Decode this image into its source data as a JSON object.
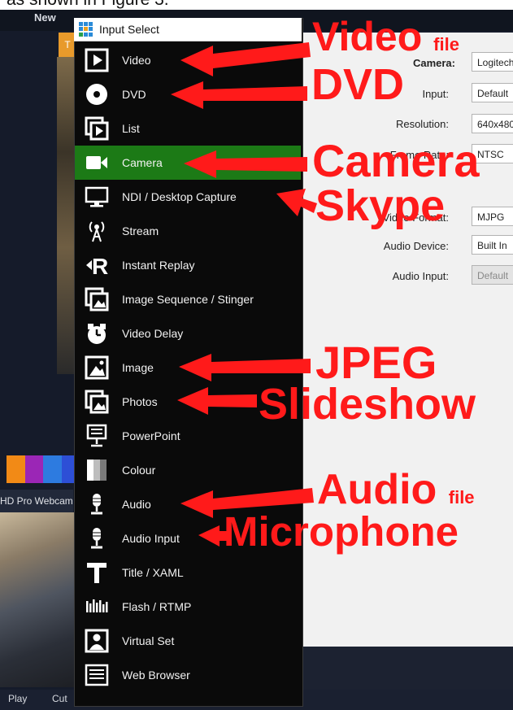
{
  "document": {
    "caption_fragment": "as shown in Figure 3."
  },
  "app": {
    "new_label": "New",
    "orange_tab_label": "T",
    "webcam_label": "HD Pro Webcam",
    "bottom_buttons": [
      "Play",
      "Cut"
    ],
    "swatch_colors": [
      "#f28a16",
      "#9b26b6",
      "#2d7be0",
      "#2d4fd6"
    ]
  },
  "dialog": {
    "title": "Input Select",
    "items": [
      {
        "label": "Video",
        "icon": "video-file-icon"
      },
      {
        "label": "DVD",
        "icon": "disc-icon"
      },
      {
        "label": "List",
        "icon": "list-icon"
      },
      {
        "label": "Camera",
        "icon": "camera-icon",
        "selected": true
      },
      {
        "label": "NDI / Desktop Capture",
        "icon": "monitor-icon"
      },
      {
        "label": "Stream",
        "icon": "antenna-icon"
      },
      {
        "label": "Instant Replay",
        "icon": "replay-icon"
      },
      {
        "label": "Image Sequence / Stinger",
        "icon": "image-sequence-icon"
      },
      {
        "label": "Video Delay",
        "icon": "timer-icon"
      },
      {
        "label": "Image",
        "icon": "image-icon"
      },
      {
        "label": "Photos",
        "icon": "photos-icon"
      },
      {
        "label": "PowerPoint",
        "icon": "presentation-icon"
      },
      {
        "label": "Colour",
        "icon": "colour-icon"
      },
      {
        "label": "Audio",
        "icon": "microphone-icon"
      },
      {
        "label": "Audio Input",
        "icon": "microphone-input-icon"
      },
      {
        "label": "Title / XAML",
        "icon": "title-icon"
      },
      {
        "label": "Flash / RTMP",
        "icon": "flash-icon"
      },
      {
        "label": "Virtual Set",
        "icon": "virtual-set-icon"
      },
      {
        "label": "Web Browser",
        "icon": "web-browser-icon"
      }
    ]
  },
  "settings": {
    "fields": [
      {
        "label": "Camera:",
        "value": "Logitech"
      },
      {
        "label": "Input:",
        "value": "Default"
      },
      {
        "label": "Resolution:",
        "value": "640x480"
      },
      {
        "label": "Frame Rate:",
        "value": "NTSC"
      },
      {
        "label": "Video Format:",
        "value": "MJPG"
      },
      {
        "label": "Audio Device:",
        "value": "Built In"
      },
      {
        "label": "Audio Input:",
        "value": "Default"
      }
    ]
  },
  "annotations": {
    "video_main": "Video",
    "video_small": "file",
    "dvd": "DVD",
    "camera": "Camera",
    "skype": "Skype",
    "jpeg": "JPEG",
    "slideshow": "Slideshow",
    "audio_main": "Audio",
    "audio_small": "file",
    "microphone": "Microphone"
  },
  "colors": {
    "annotation": "#ff1a1a",
    "selected_row": "#1c7a16"
  }
}
